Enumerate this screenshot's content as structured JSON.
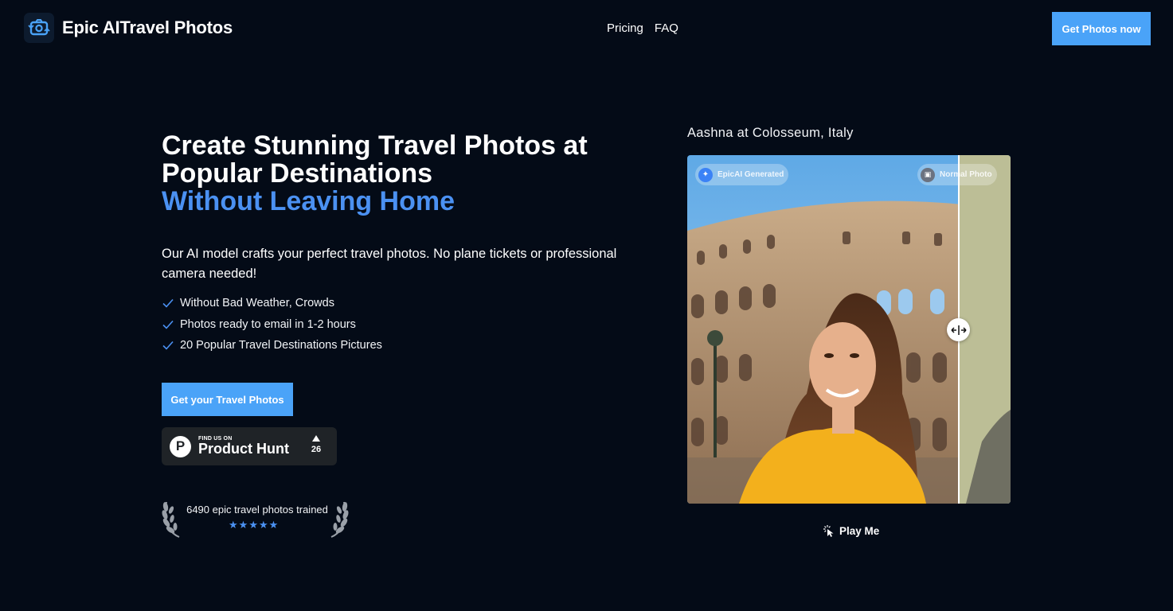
{
  "header": {
    "brand": "Epic AITravel Photos",
    "logo_icon": "camera-swap-icon",
    "nav": [
      {
        "label": "Pricing"
      },
      {
        "label": "FAQ"
      }
    ],
    "cta_label": "Get Photos now"
  },
  "hero": {
    "title_line1": "Create Stunning Travel Photos at",
    "title_line2": "Popular Destinations",
    "title_accent": "Without Leaving Home",
    "subtitle": "Our AI model crafts your perfect travel photos. No plane tickets or professional camera needed!",
    "features": [
      {
        "label": "Without Bad Weather, Crowds"
      },
      {
        "label": "Photos ready to email in 1-2 hours"
      },
      {
        "label": "20 Popular Travel Destinations Pictures"
      }
    ],
    "cta_label": "Get your Travel Photos",
    "product_hunt": {
      "small": "FIND US ON",
      "name": "Product Hunt",
      "votes": "26"
    },
    "trained_text": "6490 epic travel photos trained",
    "rating_stars": 5
  },
  "showcase": {
    "caption": "Aashna at Colosseum, Italy",
    "left_label": "EpicAI Generated",
    "right_label": "Normal Photo",
    "slider_position": 0.84,
    "play_label": "Play Me"
  },
  "colors": {
    "background": "#040b17",
    "accent": "#4b91f2",
    "button": "#4aa3f8"
  }
}
